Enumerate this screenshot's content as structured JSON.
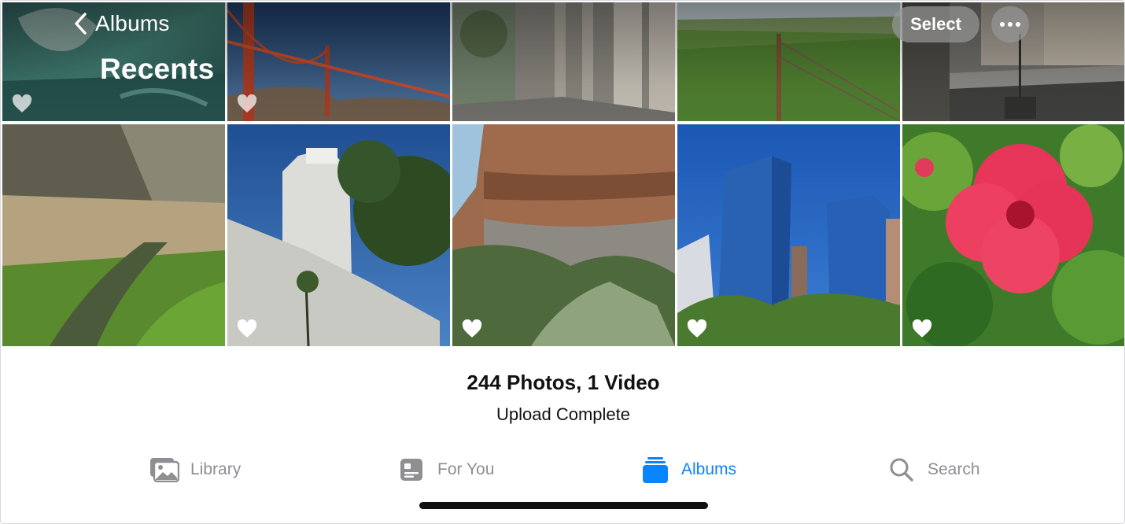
{
  "nav": {
    "back_label": "Albums",
    "title": "Recents",
    "select_label": "Select"
  },
  "photos": [
    {
      "name": "aquarium-fish",
      "favorite_visible": true
    },
    {
      "name": "golden-gate-bridge",
      "favorite_visible": true
    },
    {
      "name": "building-columns-sidewalk",
      "favorite_visible": false
    },
    {
      "name": "grass-fence-hill",
      "favorite_visible": false
    },
    {
      "name": "city-street",
      "favorite_visible": false
    },
    {
      "name": "creek-meadow",
      "favorite_visible": false
    },
    {
      "name": "city-hall-tower",
      "favorite_visible": true
    },
    {
      "name": "red-rock-cliff",
      "favorite_visible": true
    },
    {
      "name": "blue-skyscrapers",
      "favorite_visible": true
    },
    {
      "name": "pink-hibiscus",
      "favorite_visible": true
    }
  ],
  "summary": {
    "count": "244 Photos, 1 Video",
    "status": "Upload Complete"
  },
  "tabs": [
    {
      "label": "Library",
      "icon": "photo-library-icon",
      "active": false
    },
    {
      "label": "For You",
      "icon": "for-you-icon",
      "active": false
    },
    {
      "label": "Albums",
      "icon": "albums-icon",
      "active": true
    },
    {
      "label": "Search",
      "icon": "magnifier-icon",
      "active": false
    }
  ],
  "colors": {
    "accent": "#0a84ff",
    "inactive": "#8e8e93",
    "nav_pill": "#969696"
  }
}
